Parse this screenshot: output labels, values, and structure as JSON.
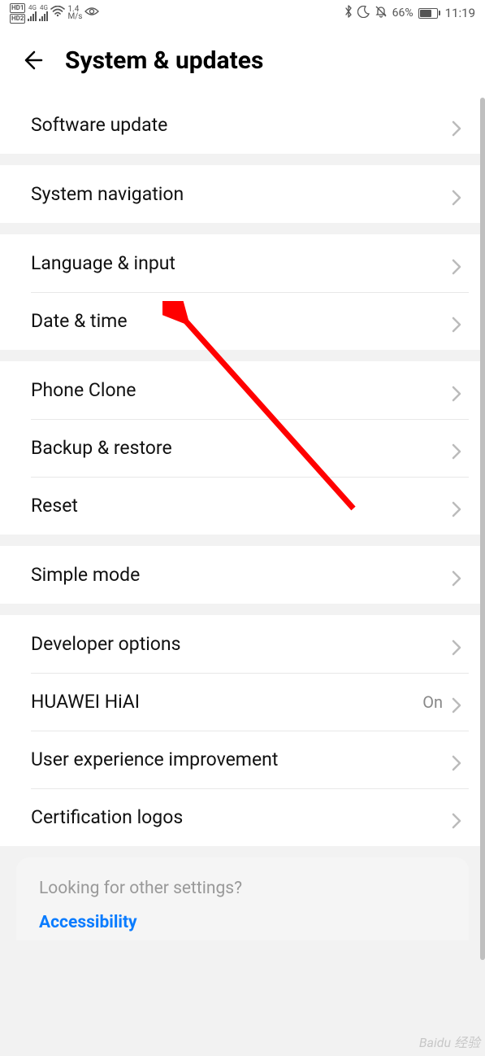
{
  "statusbar": {
    "hd1": "HD1",
    "hd2": "HD2",
    "net1": "4G",
    "net2": "4G",
    "speed_value": "1.4",
    "speed_unit": "M/s",
    "battery_pct": "66%",
    "time": "11:19"
  },
  "header": {
    "title": "System & updates"
  },
  "groups": [
    {
      "items": [
        {
          "label": "Software update"
        }
      ]
    },
    {
      "items": [
        {
          "label": "System navigation"
        }
      ]
    },
    {
      "items": [
        {
          "label": "Language & input"
        },
        {
          "label": "Date & time"
        }
      ]
    },
    {
      "items": [
        {
          "label": "Phone Clone"
        },
        {
          "label": "Backup & restore"
        },
        {
          "label": "Reset"
        }
      ]
    },
    {
      "items": [
        {
          "label": "Simple mode"
        }
      ]
    },
    {
      "items": [
        {
          "label": "Developer options"
        },
        {
          "label": "HUAWEI HiAI",
          "value": "On"
        },
        {
          "label": "User experience improvement"
        },
        {
          "label": "Certification logos"
        }
      ]
    }
  ],
  "footer": {
    "prompt": "Looking for other settings?",
    "link": "Accessibility"
  },
  "watermark": "Baidu 经验"
}
